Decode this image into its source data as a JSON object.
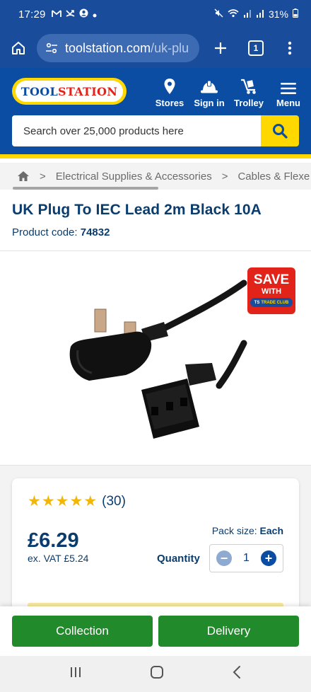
{
  "status_bar": {
    "time": "17:29",
    "battery": "31%",
    "icons": [
      "gmail-icon",
      "missed-call-icon",
      "account-circle-icon",
      "dot-icon",
      "mute-icon",
      "wifi-icon",
      "signal-icon",
      "signal-icon",
      "battery-icon"
    ]
  },
  "browser": {
    "url_main": "toolstation.com",
    "url_rest": "/uk-plu",
    "tab_count": "1"
  },
  "site_header": {
    "logo_part1": "TOOL",
    "logo_part2": "STATION",
    "nav": [
      {
        "label": "Stores",
        "icon": "map-pin-icon"
      },
      {
        "label": "Sign in",
        "icon": "hard-hat-icon"
      },
      {
        "label": "Trolley",
        "icon": "trolley-icon"
      },
      {
        "label": "Menu",
        "icon": "hamburger-icon"
      }
    ],
    "search_placeholder": "Search over 25,000 products here"
  },
  "breadcrumb": {
    "items": [
      "Electrical Supplies & Accessories",
      "Cables & Flexe"
    ]
  },
  "product": {
    "title": "UK Plug To IEC Lead 2m Black 10A",
    "code_label": "Product code:",
    "code": "74832",
    "badge": {
      "line1": "SAVE",
      "line2": "WITH",
      "line3_logo": "TS",
      "line3": "TRADE CLUB"
    },
    "rating_count": "(30)",
    "rating": 5,
    "price": "£6.29",
    "ex_vat": "ex. VAT £5.24",
    "pack_size_label": "Pack size:",
    "pack_size_value": "Each",
    "quantity_label": "Quantity",
    "quantity_value": "1"
  },
  "actions": {
    "collection": "Collection",
    "delivery": "Delivery"
  },
  "colors": {
    "brand_blue": "#0b4da2",
    "brand_yellow": "#ffd800",
    "action_green": "#218a2b",
    "badge_red": "#e2231a",
    "star_gold": "#f2b705"
  }
}
